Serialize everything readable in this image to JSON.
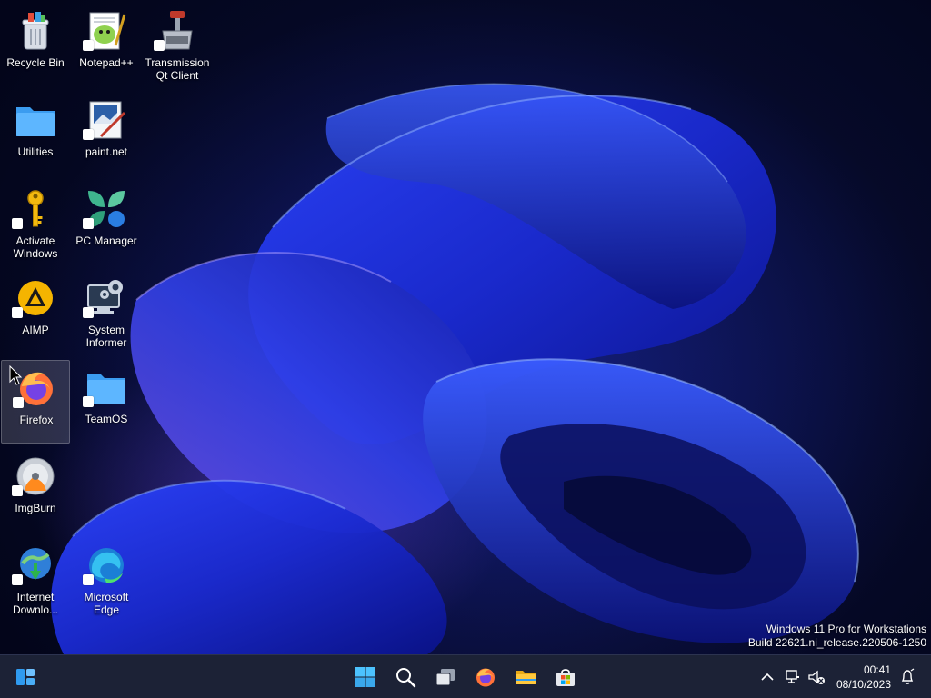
{
  "desktop": {
    "icons": [
      {
        "label": "Recycle Bin",
        "icon": "recycle-bin-icon"
      },
      {
        "label": "Notepad++",
        "icon": "notepad-plus-plus-icon"
      },
      {
        "label": "Transmission Qt Client",
        "icon": "transmission-icon"
      },
      {
        "label": "Utilities",
        "icon": "folder-icon"
      },
      {
        "label": "paint.net",
        "icon": "paint-net-icon"
      },
      {
        "label": "Activate Windows",
        "icon": "key-icon"
      },
      {
        "label": "PC Manager",
        "icon": "pc-manager-icon"
      },
      {
        "label": "AIMP",
        "icon": "aimp-icon"
      },
      {
        "label": "System Informer",
        "icon": "system-informer-icon"
      },
      {
        "label": "Firefox",
        "icon": "firefox-icon"
      },
      {
        "label": "TeamOS",
        "icon": "folder-icon"
      },
      {
        "label": "ImgBurn",
        "icon": "imgburn-icon"
      },
      {
        "label": "Internet Downlo...",
        "icon": "internet-download-manager-icon"
      },
      {
        "label": "Microsoft Edge",
        "icon": "edge-icon"
      }
    ]
  },
  "watermark": {
    "line1": "Windows 11 Pro for Workstations",
    "line2": "Build 22621.ni_release.220506-1250"
  },
  "taskbar": {
    "left_widget": "widgets-icon",
    "apps": [
      "start-icon",
      "search-icon",
      "task-view-icon",
      "firefox-icon",
      "file-explorer-icon",
      "microsoft-store-icon"
    ],
    "tray": {
      "time": "00:41",
      "date": "08/10/2023"
    }
  },
  "colors": {
    "taskbar_bg": "#1c2236",
    "accent": "#4cc2ff"
  }
}
